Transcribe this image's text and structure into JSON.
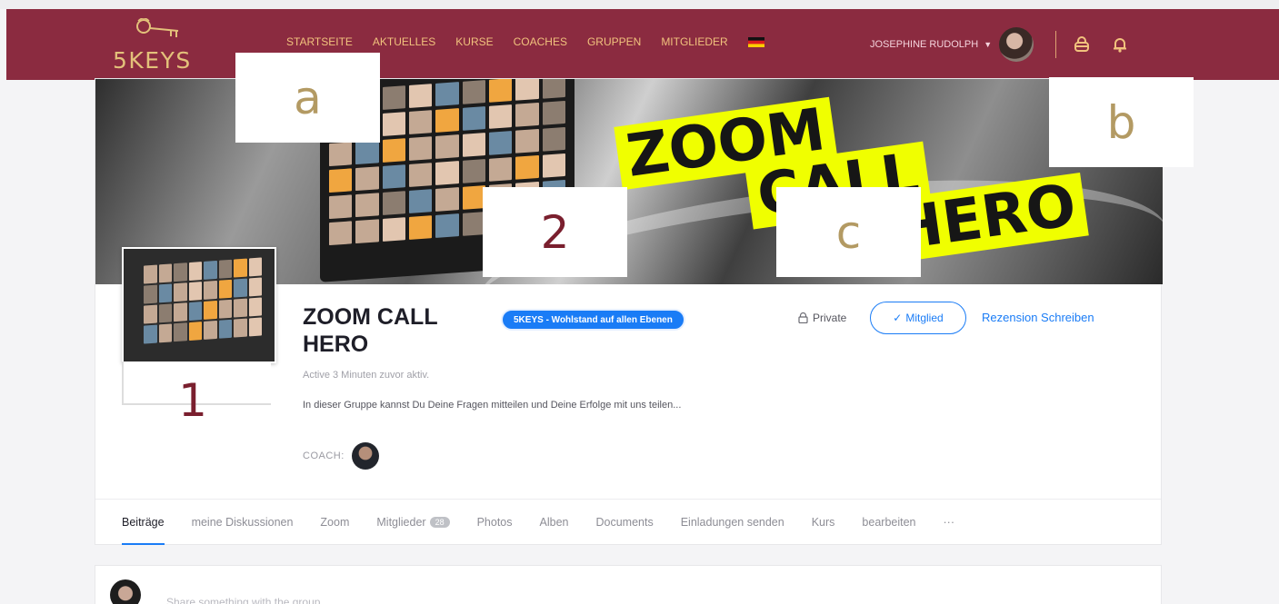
{
  "brand": {
    "logo_text": "5KEYS",
    "color": "#e3c17a",
    "nav_bg": "#8b2b40",
    "accent": "#1a7cf6"
  },
  "nav": {
    "items": [
      "STARTSEITE",
      "AKTUELLES",
      "KURSE",
      "COACHES",
      "GRUPPEN",
      "MITGLIEDER"
    ],
    "flag_icon": "german-flag-icon",
    "user_name": "JOSEPHINE RUDOLPH",
    "icons": [
      "chevron-down-icon",
      "cart-icon",
      "bell-icon"
    ]
  },
  "cover": {
    "banner_words": [
      "ZOOM",
      "CALL",
      "HERO"
    ]
  },
  "labels": {
    "a": "a",
    "b": "b",
    "c": "c",
    "one": "1",
    "two": "2"
  },
  "group": {
    "title": "ZOOM CALL HERO",
    "badge": "5KEYS - Wohlstand auf allen Ebenen",
    "active": "Active 3 Minuten zuvor aktiv.",
    "description": "In dieser Gruppe kannst Du Deine Fragen mitteilen und Deine Erfolge mit uns teilen...",
    "coach_label": "COACH:",
    "privacy": "Private",
    "member_button": "Mitglied",
    "review_link": "Rezension Schreiben"
  },
  "tabs": [
    {
      "label": "Beiträge",
      "active": true
    },
    {
      "label": "meine Diskussionen"
    },
    {
      "label": "Zoom"
    },
    {
      "label": "Mitglieder",
      "count": "28"
    },
    {
      "label": "Photos"
    },
    {
      "label": "Alben"
    },
    {
      "label": "Documents"
    },
    {
      "label": "Einladungen senden"
    },
    {
      "label": "Kurs"
    },
    {
      "label": "bearbeiten"
    },
    {
      "label": "···"
    }
  ],
  "composer": {
    "placeholder": "Share something with the group..."
  }
}
